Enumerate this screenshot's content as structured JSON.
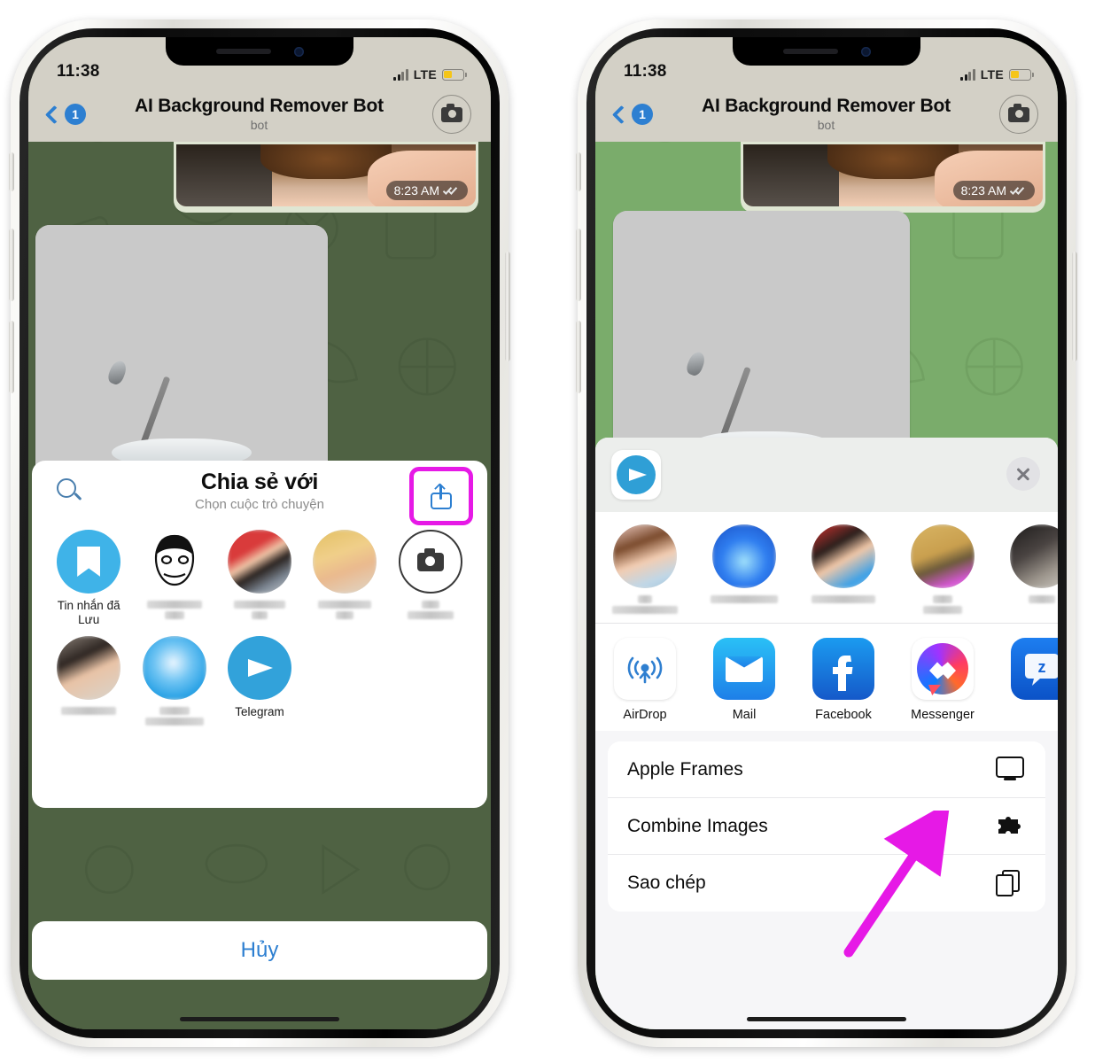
{
  "status_bar": {
    "time": "11:38",
    "network": "LTE",
    "battery_level_pct": 44
  },
  "chat_header": {
    "back_badge": "1",
    "title": "AI Background Remover Bot",
    "subtitle": "bot",
    "camera_icon": "camera-icon"
  },
  "chat": {
    "sent_message_time": "8:23 AM",
    "read_receipt": "double-check-icon"
  },
  "left_phone": {
    "telegram_share_sheet": {
      "search_icon": "search-icon",
      "title": "Chia sẻ với",
      "subtitle": "Chọn cuộc trò chuyện",
      "share_button_icon": "ios-share-icon",
      "share_button_highlight_color": "#e619e6",
      "contacts": [
        {
          "label": "Tin nhắn đã Lưu",
          "avatar": "saved-messages-icon",
          "blurred": false
        },
        {
          "label": "",
          "avatar": "contact-face-drawing",
          "blurred": true
        },
        {
          "label": "",
          "avatar": "contact-photo",
          "blurred": true
        },
        {
          "label": "",
          "avatar": "contact-photo",
          "blurred": true
        },
        {
          "label": "",
          "avatar": "camera-icon",
          "blurred": true
        },
        {
          "label": "",
          "avatar": "contact-photo",
          "blurred": true
        },
        {
          "label": "",
          "avatar": "contact-photo",
          "blurred": true
        },
        {
          "label": "Telegram",
          "avatar": "telegram-icon",
          "blurred": false
        }
      ],
      "cancel_label": "Hủy"
    }
  },
  "right_phone": {
    "ios_share_sheet": {
      "source_app_icon": "telegram-icon",
      "close_icon": "close-icon",
      "contacts": [
        {
          "label": "",
          "blurred": true
        },
        {
          "label": "",
          "blurred": true
        },
        {
          "label": "",
          "blurred": true
        },
        {
          "label": "",
          "blurred": true
        },
        {
          "label": "",
          "blurred": true
        }
      ],
      "apps": [
        {
          "label": "AirDrop",
          "icon": "airdrop-icon"
        },
        {
          "label": "Mail",
          "icon": "mail-icon"
        },
        {
          "label": "Facebook",
          "icon": "facebook-icon"
        },
        {
          "label": "Messenger",
          "icon": "messenger-icon"
        },
        {
          "label": "",
          "icon": "zalo-icon"
        }
      ],
      "actions": [
        {
          "label": "Apple Frames",
          "icon": "frame-icon"
        },
        {
          "label": "Combine Images",
          "icon": "puzzle-icon"
        },
        {
          "label": "Sao chép",
          "icon": "copy-icon"
        }
      ]
    },
    "annotation": {
      "arrow_color": "#e619e6",
      "points_at": "Messenger"
    }
  }
}
